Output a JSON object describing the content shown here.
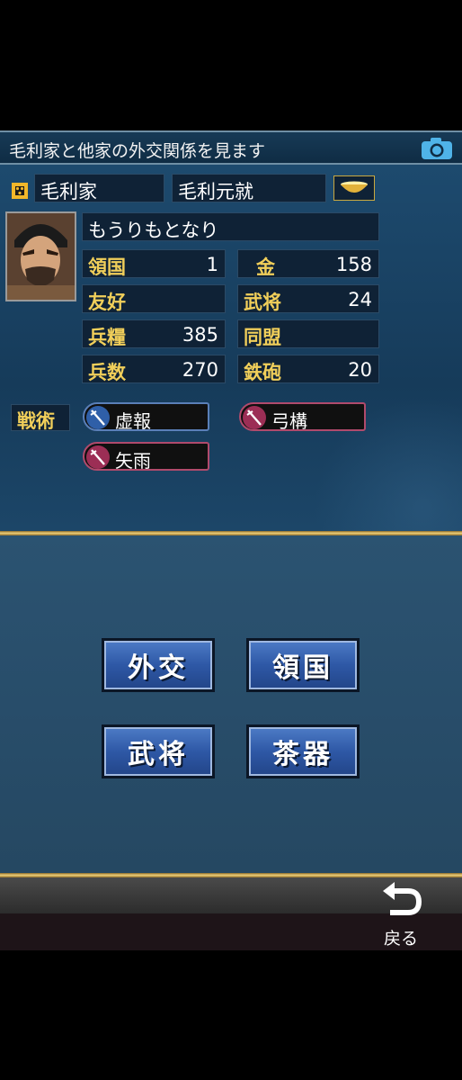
{
  "header": {
    "title": "毛利家と他家の外交関係を見ます",
    "camera_icon": "camera-icon"
  },
  "clan": {
    "clan_name": "毛利家",
    "leader_name": "毛利元就",
    "leader_reading": "もうりもとなり",
    "emblem_icon": "clan-emblem-icon",
    "tea_bowl_icon": "tea-bowl-icon"
  },
  "stats": {
    "territory_label": "領国",
    "territory_value": "1",
    "gold_label": "金",
    "gold_value": "158",
    "friendship_label": "友好",
    "friendship_value": "",
    "generals_label": "武将",
    "generals_value": "24",
    "food_label": "兵糧",
    "food_value": "385",
    "alliance_label": "同盟",
    "alliance_value": "",
    "troops_label": "兵数",
    "troops_value": "270",
    "guns_label": "鉄砲",
    "guns_value": "20"
  },
  "tactics": {
    "label": "戦術",
    "items": [
      {
        "name": "虚報",
        "color": "#2f5fa8"
      },
      {
        "name": "弓構",
        "color": "#9c2e55"
      },
      {
        "name": "矢雨",
        "color": "#9c2e55"
      }
    ]
  },
  "menu": {
    "diplomacy": "外交",
    "territory": "領国",
    "generals": "武将",
    "tea_utensils": "茶器"
  },
  "footer": {
    "back_label": "戻る",
    "back_icon": "return-arrow-icon"
  },
  "colors": {
    "label_gold": "#f1cf5a",
    "button_blue": "#2e58a6",
    "divider_gold": "#f0d27a"
  }
}
